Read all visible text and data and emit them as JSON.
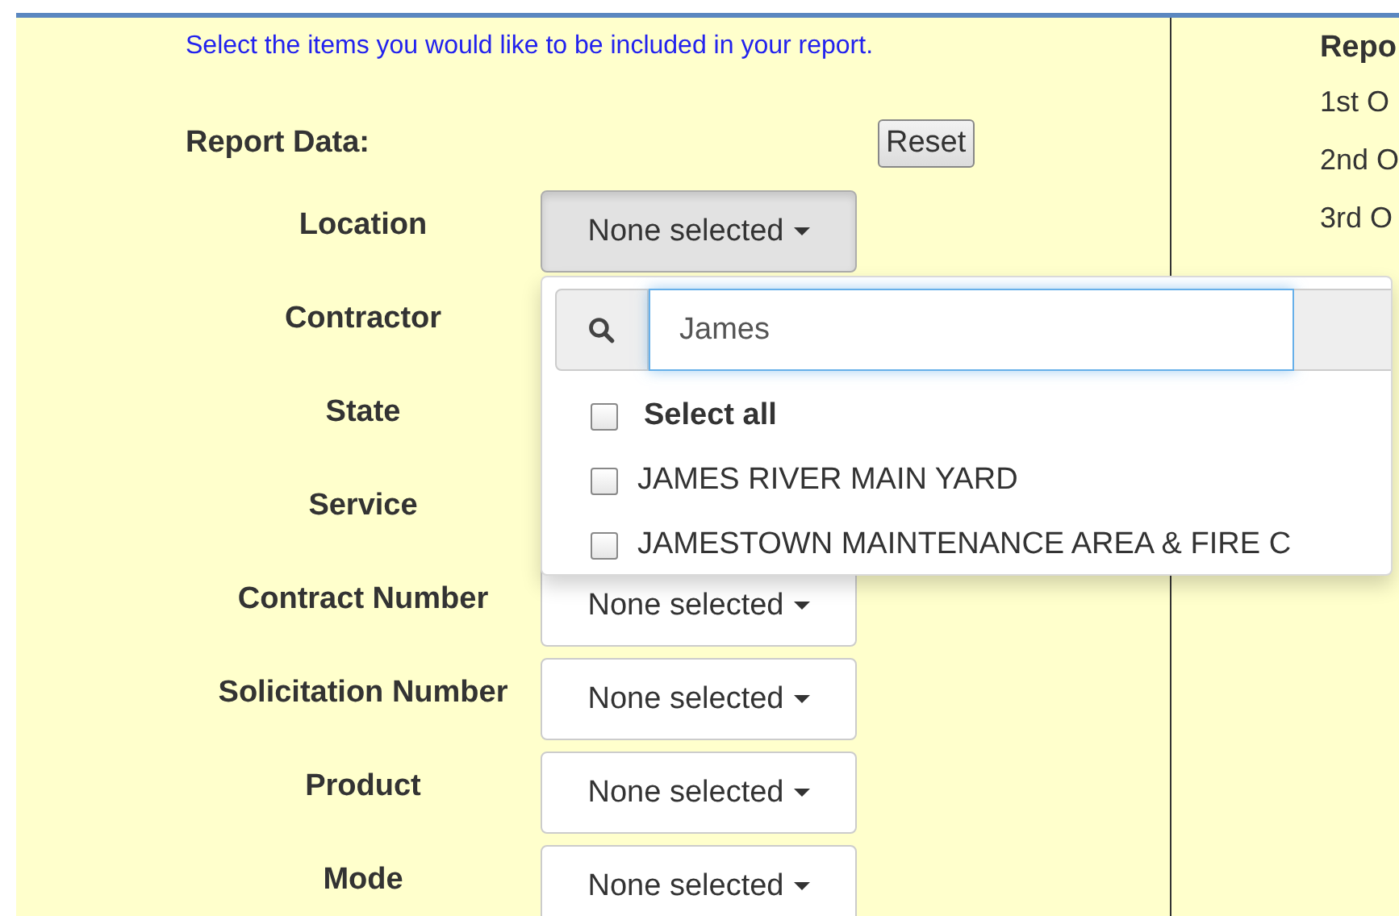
{
  "instruction": "Select the items you would like to be included in your report.",
  "report_data_label": "Report Data:",
  "reset_button": "Reset",
  "filters": [
    {
      "label": "Location",
      "value": "None selected",
      "open": true
    },
    {
      "label": "Contractor",
      "open": false
    },
    {
      "label": "State",
      "open": false
    },
    {
      "label": "Service",
      "open": false
    },
    {
      "label": "Contract Number",
      "value": "None selected",
      "open": false
    },
    {
      "label": "Solicitation Number",
      "value": "None selected",
      "open": false
    },
    {
      "label": "Product",
      "value": "None selected",
      "open": false
    },
    {
      "label": "Mode",
      "value": "None selected",
      "open": false
    }
  ],
  "location_menu": {
    "search": {
      "value": "James"
    },
    "options": [
      {
        "label": "Select all",
        "kind": "select-all",
        "checked": false
      },
      {
        "label": "JAMES RIVER MAIN YARD",
        "kind": "option",
        "checked": false
      },
      {
        "label": "JAMESTOWN MAINTENANCE AREA & FIRE C",
        "kind": "option",
        "checked": false
      }
    ]
  },
  "right_panel": {
    "heading": "Repo",
    "items": [
      "1st O",
      "2nd O",
      "3rd O"
    ]
  }
}
